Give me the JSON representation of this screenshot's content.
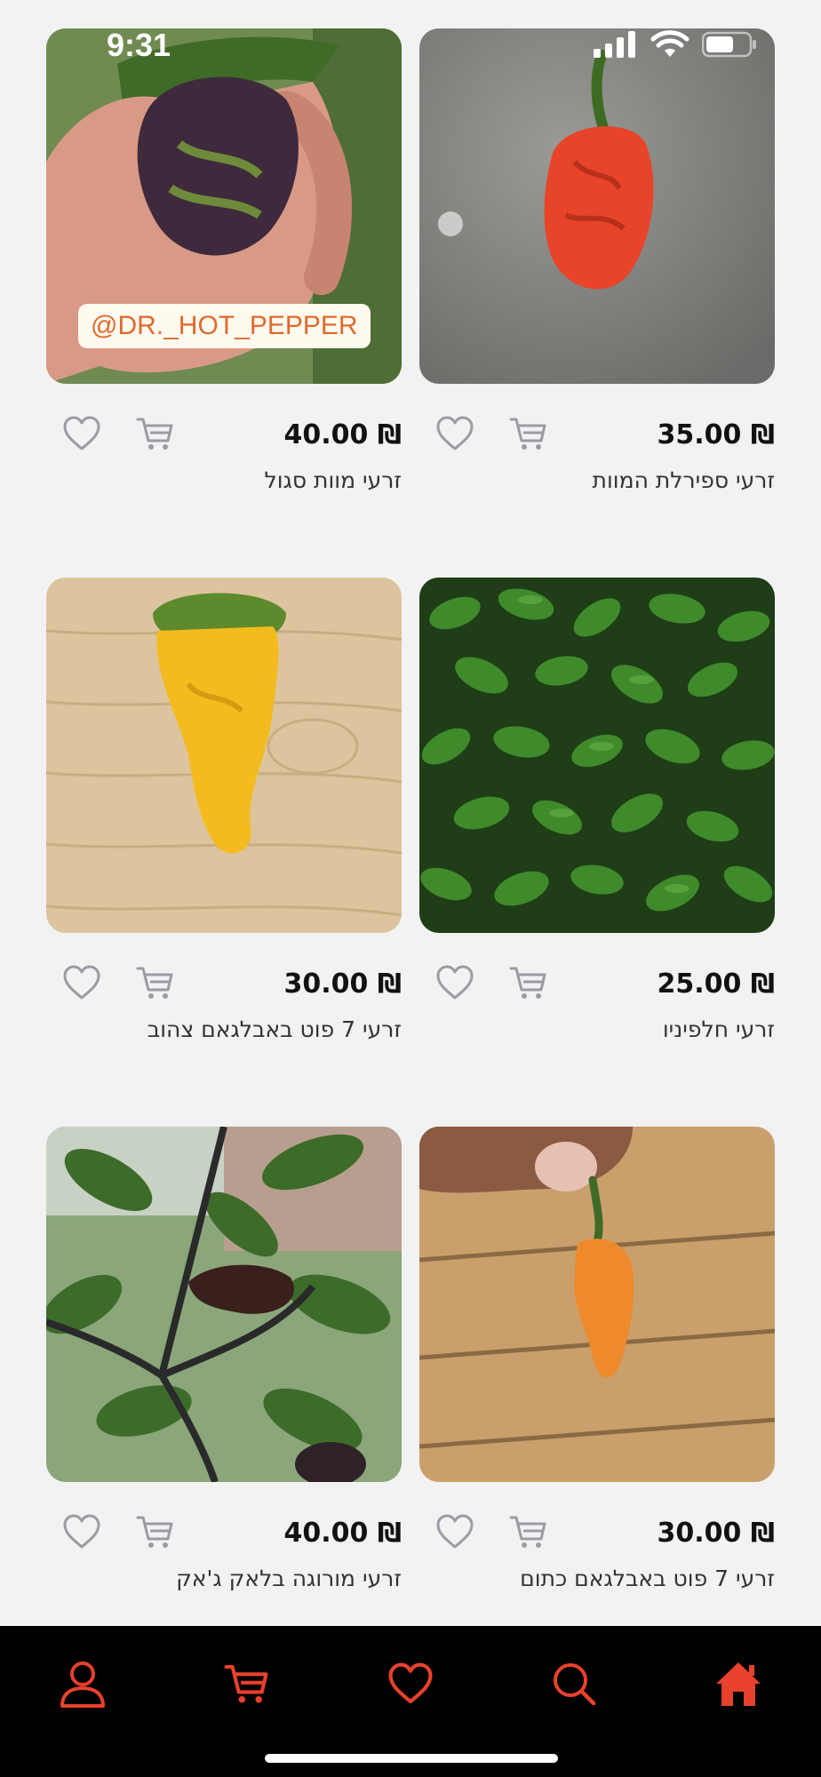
{
  "status_bar": {
    "time": "9:31",
    "icons": [
      "signal-icon",
      "wifi-icon",
      "battery-icon"
    ]
  },
  "products": [
    {
      "name": "זרעי ספירלת המוות",
      "price": "₪ 35.00",
      "image": "red-pepper-photo"
    },
    {
      "name": "זרעי מוות סגול",
      "price": "₪ 40.00",
      "image": "purple-pepper-photo",
      "watermark": "@DR._HOT_PEPPER"
    },
    {
      "name": "זרעי חלפיניו",
      "price": "₪ 25.00",
      "image": "jalapeno-pile-photo"
    },
    {
      "name": "זרעי 7 פוט באבלגאם צהוב",
      "price": "₪ 30.00",
      "image": "yellow-pepper-photo"
    },
    {
      "name": "זרעי 7 פוט באבלגאם כתום",
      "price": "₪ 30.00",
      "image": "orange-pepper-photo"
    },
    {
      "name": "זרעי מורוגה בלאק ג'אק",
      "price": "₪ 40.00",
      "image": "black-pepper-plant-photo"
    }
  ],
  "bottom_nav": [
    "profile-icon",
    "cart-icon",
    "heart-icon",
    "search-icon",
    "home-icon"
  ],
  "colors": {
    "accent": "#e8412c",
    "background": "#f2f2f2",
    "nav_background": "#000000",
    "icon_gray": "#9a9ca3"
  }
}
